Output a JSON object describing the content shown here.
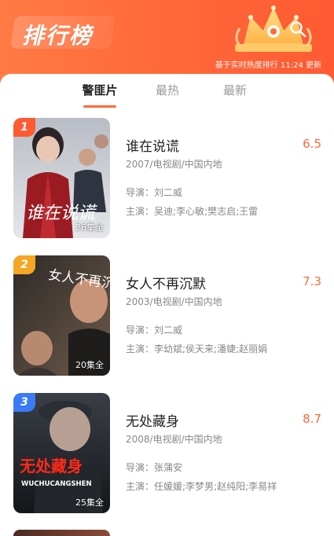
{
  "header": {
    "title": "排行榜",
    "update_note": "基于实时热度排行 11:24 更新"
  },
  "tabs": [
    {
      "label": "警匪片",
      "active": true
    },
    {
      "label": "最热",
      "active": false
    },
    {
      "label": "最新",
      "active": false
    }
  ],
  "items": [
    {
      "rank": "1",
      "rank_color": "#ff5a33",
      "title": "谁在说谎",
      "score": "6.5",
      "meta": "2007/电视剧/中国内地",
      "director": "导演：刘二威",
      "cast": "主演：吴迪;李心敏;樊志启;王雷",
      "episodes": "26集全",
      "poster_text": "谁在说谎"
    },
    {
      "rank": "2",
      "rank_color": "#f5a623",
      "title": "女人不再沉默",
      "score": "7.3",
      "meta": "2003/电视剧/中国内地",
      "director": "导演：刘二威",
      "cast": "主演：李幼斌;侯天来;潘婕;赵丽娟",
      "episodes": "20集全",
      "poster_text": "女人不再沉默"
    },
    {
      "rank": "3",
      "rank_color": "#3b7bf6",
      "title": "无处藏身",
      "score": "8.7",
      "meta": "2008/电视剧/中国内地",
      "director": "导演：张蒲安",
      "cast": "主演：任媛媛;李梦男;赵纯阳;李易祥",
      "episodes": "25集全",
      "poster_text": "无处藏身",
      "poster_subtext": "WUCHUCANGSHEN"
    }
  ],
  "colors": {
    "accent": "#ff6a3a",
    "score": "#ff6a3a",
    "tab_inactive": "#999999",
    "text_primary": "#222222",
    "text_secondary": "#888888"
  },
  "icons": {
    "crown": "crown-icon",
    "search": "search-icon"
  }
}
